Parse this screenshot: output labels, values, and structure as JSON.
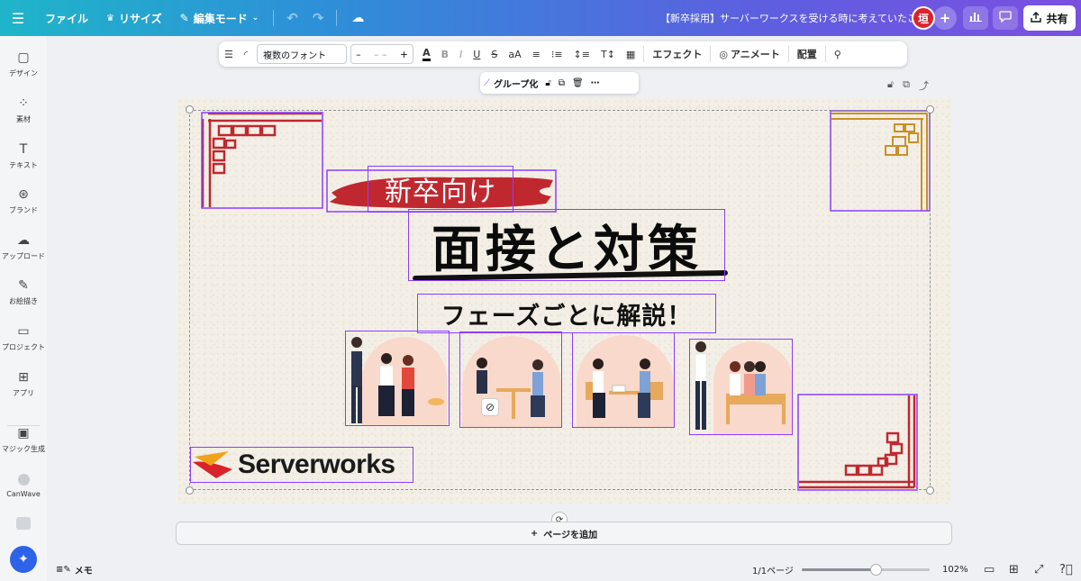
{
  "topbar": {
    "menu_icon": "hamburger-icon",
    "file_label": "ファイル",
    "resize_label": "リサイズ",
    "edit_mode_label": "編集モード",
    "doc_title": "【新卒採用】サーバーワークスを受ける時に考えていたこと",
    "avatar_initial": "垣",
    "share_label": "共有"
  },
  "sidebar": {
    "items": [
      {
        "label": "デザイン",
        "icon": "design-icon"
      },
      {
        "label": "素材",
        "icon": "elements-icon"
      },
      {
        "label": "テキスト",
        "icon": "text-icon"
      },
      {
        "label": "ブランド",
        "icon": "brand-icon"
      },
      {
        "label": "アップロード",
        "icon": "upload-icon"
      },
      {
        "label": "お絵描き",
        "icon": "draw-icon"
      },
      {
        "label": "プロジェクト",
        "icon": "folder-icon"
      },
      {
        "label": "アプリ",
        "icon": "apps-icon"
      },
      {
        "label": "マジック生成",
        "icon": "magic-media-icon"
      },
      {
        "label": "CanWave",
        "icon": "canwave-icon"
      }
    ]
  },
  "format_toolbar": {
    "font_name": "複数のフォント",
    "font_size": "– –",
    "case_label": "aA",
    "effects_label": "エフェクト",
    "animate_label": "アニメート",
    "position_label": "配置"
  },
  "group_popup": {
    "group_label": "グループ化"
  },
  "slide": {
    "tag": "新卒向け",
    "title": "面接と対策",
    "subtitle": "フェーズごとに解説！",
    "logo_text": "Serverworks"
  },
  "add_page_label": "ページを追加",
  "bottombar": {
    "memo_label": "メモ",
    "pages": "1/1ページ",
    "zoom": "102%",
    "zoom_level": 0.58
  },
  "colors": {
    "accent_purple": "#8b3dff",
    "frame_red": "#c0282f",
    "frame_gold": "#c9902a",
    "logo_red": "#d8232a"
  }
}
